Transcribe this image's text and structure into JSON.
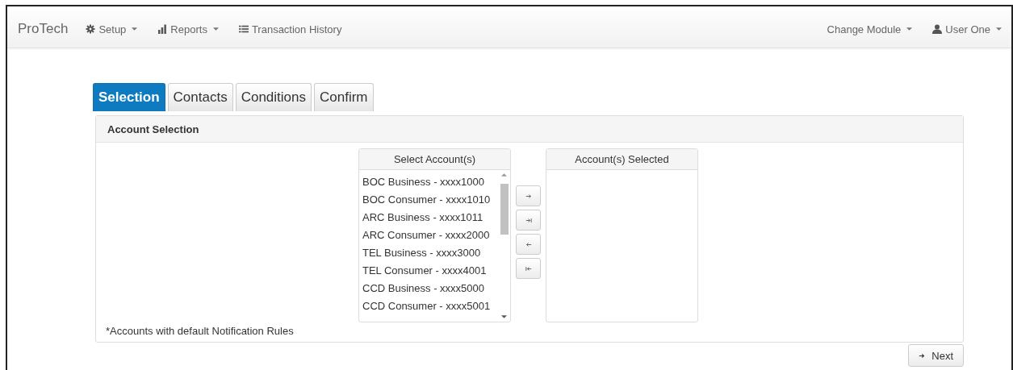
{
  "navbar": {
    "brand": "ProTech",
    "left_items": [
      {
        "kind": "gear",
        "label": "Setup",
        "dropdown": true
      },
      {
        "kind": "chart",
        "label": "Reports",
        "dropdown": true
      },
      {
        "kind": "list",
        "label": "Transaction History",
        "dropdown": false
      }
    ],
    "right_items": [
      {
        "kind": "none",
        "label": "Change Module",
        "dropdown": true
      },
      {
        "kind": "user",
        "label": "User One",
        "dropdown": true
      }
    ]
  },
  "tabs": [
    {
      "label": "Selection",
      "selected": true
    },
    {
      "label": "Contacts",
      "selected": false
    },
    {
      "label": "Conditions",
      "selected": false
    },
    {
      "label": "Confirm",
      "selected": false
    }
  ],
  "panel": {
    "title": "Account Selection",
    "available": {
      "heading": "Select Account(s)",
      "items": [
        "BOC Business - xxxx1000",
        "BOC Consumer - xxxx1010",
        "ARC Business - xxxx1011",
        "ARC Consumer - xxxx2000",
        "TEL Business - xxxx3000",
        "TEL Consumer - xxxx4001",
        "CCD Business - xxxx5000",
        "CCD Consumer - xxxx5001"
      ]
    },
    "move_buttons": [
      {
        "kind": "right"
      },
      {
        "kind": "all-right"
      },
      {
        "kind": "left"
      },
      {
        "kind": "all-left"
      }
    ],
    "selected": {
      "heading": "Account(s) Selected"
    },
    "footnote": "*Accounts with default Notification Rules"
  },
  "next_button": "Next"
}
